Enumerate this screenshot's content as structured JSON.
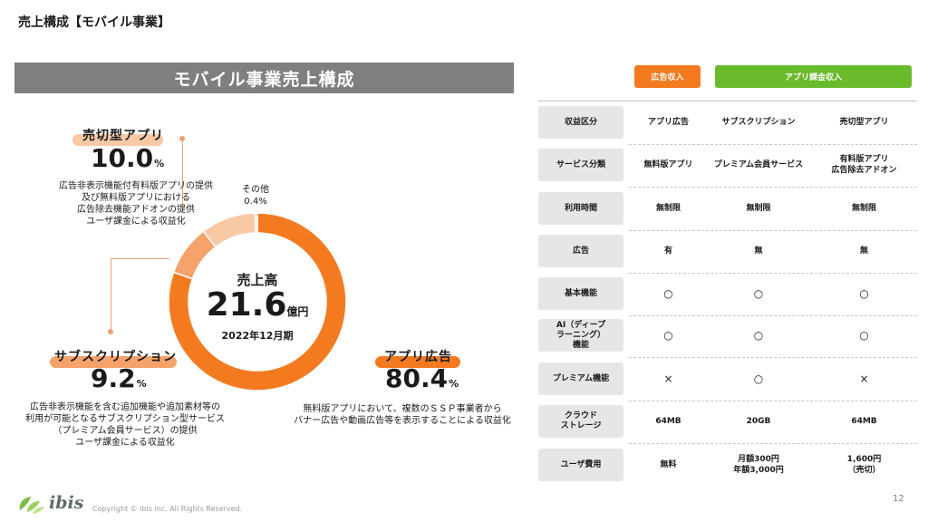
{
  "page": {
    "title": "売上構成【モバイル事業】",
    "page_number": "12",
    "copyright": "Copyright © ibis inc. All Rights Reserved.",
    "logo_text": "ibis"
  },
  "chart_data": {
    "type": "pie",
    "title": "モバイル事業売上構成",
    "center": {
      "title": "売上高",
      "value": "21.6",
      "unit": "億円",
      "period": "2022年12月期"
    },
    "unit_suffix": "%",
    "series": [
      {
        "name": "アプリ広告",
        "value": 80.4,
        "value_label": "80.4",
        "color": "#f47a20",
        "description": [
          "無料版アプリにおいて、複数のＳＳＰ事業者から",
          "バナー広告や動画広告等を表示することによる収益化"
        ]
      },
      {
        "name": "サブスクリプション",
        "value": 9.2,
        "value_label": "9.2",
        "color": "#f5a26b",
        "description": [
          "広告非表示機能を含む追加機能や追加素材等の",
          "利用が可能となるサブスクリプション型サービス",
          "（プレミアム会員サービス）の提供",
          "ユーザ課金による収益化"
        ]
      },
      {
        "name": "売切型アプリ",
        "value": 10.0,
        "value_label": "10.0",
        "color": "#f9c9a6",
        "description": [
          "広告非表示機能付有料版アプリの提供",
          "及び無料版アプリにおける",
          "広告除去機能アドオンの提供",
          "ユーザ課金による収益化"
        ]
      },
      {
        "name": "その他",
        "value": 0.4,
        "value_label": "0.4",
        "color": "#d9d9d9",
        "description": []
      }
    ]
  },
  "legend": {
    "ad_revenue": "広告収入",
    "app_revenue": "アプリ課金収入"
  },
  "table": {
    "rows": [
      {
        "label": "収益区分",
        "cells": [
          "アプリ広告",
          "サブスクリプション",
          "売切型アプリ"
        ]
      },
      {
        "label": "サービス分類",
        "cells": [
          "無料版アプリ",
          "プレミアム会員サービス",
          "有料版アプリ\n広告除去アドオン"
        ]
      },
      {
        "label": "利用時間",
        "cells": [
          "無制限",
          "無制限",
          "無制限"
        ]
      },
      {
        "label": "広告",
        "cells": [
          "有",
          "無",
          "無"
        ]
      },
      {
        "label": "基本機能",
        "cells": [
          "○",
          "○",
          "○"
        ]
      },
      {
        "label": "AI（ディープ\nラーニング）\n機能",
        "cells": [
          "○",
          "○",
          "○"
        ]
      },
      {
        "label": "プレミアム機能",
        "cells": [
          "×",
          "○",
          "×"
        ]
      },
      {
        "label": "クラウド\nストレージ",
        "cells": [
          "64MB",
          "20GB",
          "64MB"
        ]
      },
      {
        "label": "ユーザ費用",
        "cells": [
          "無料",
          "月額300円\n年額3,000円",
          "1,600円\n（売切）"
        ]
      }
    ]
  }
}
